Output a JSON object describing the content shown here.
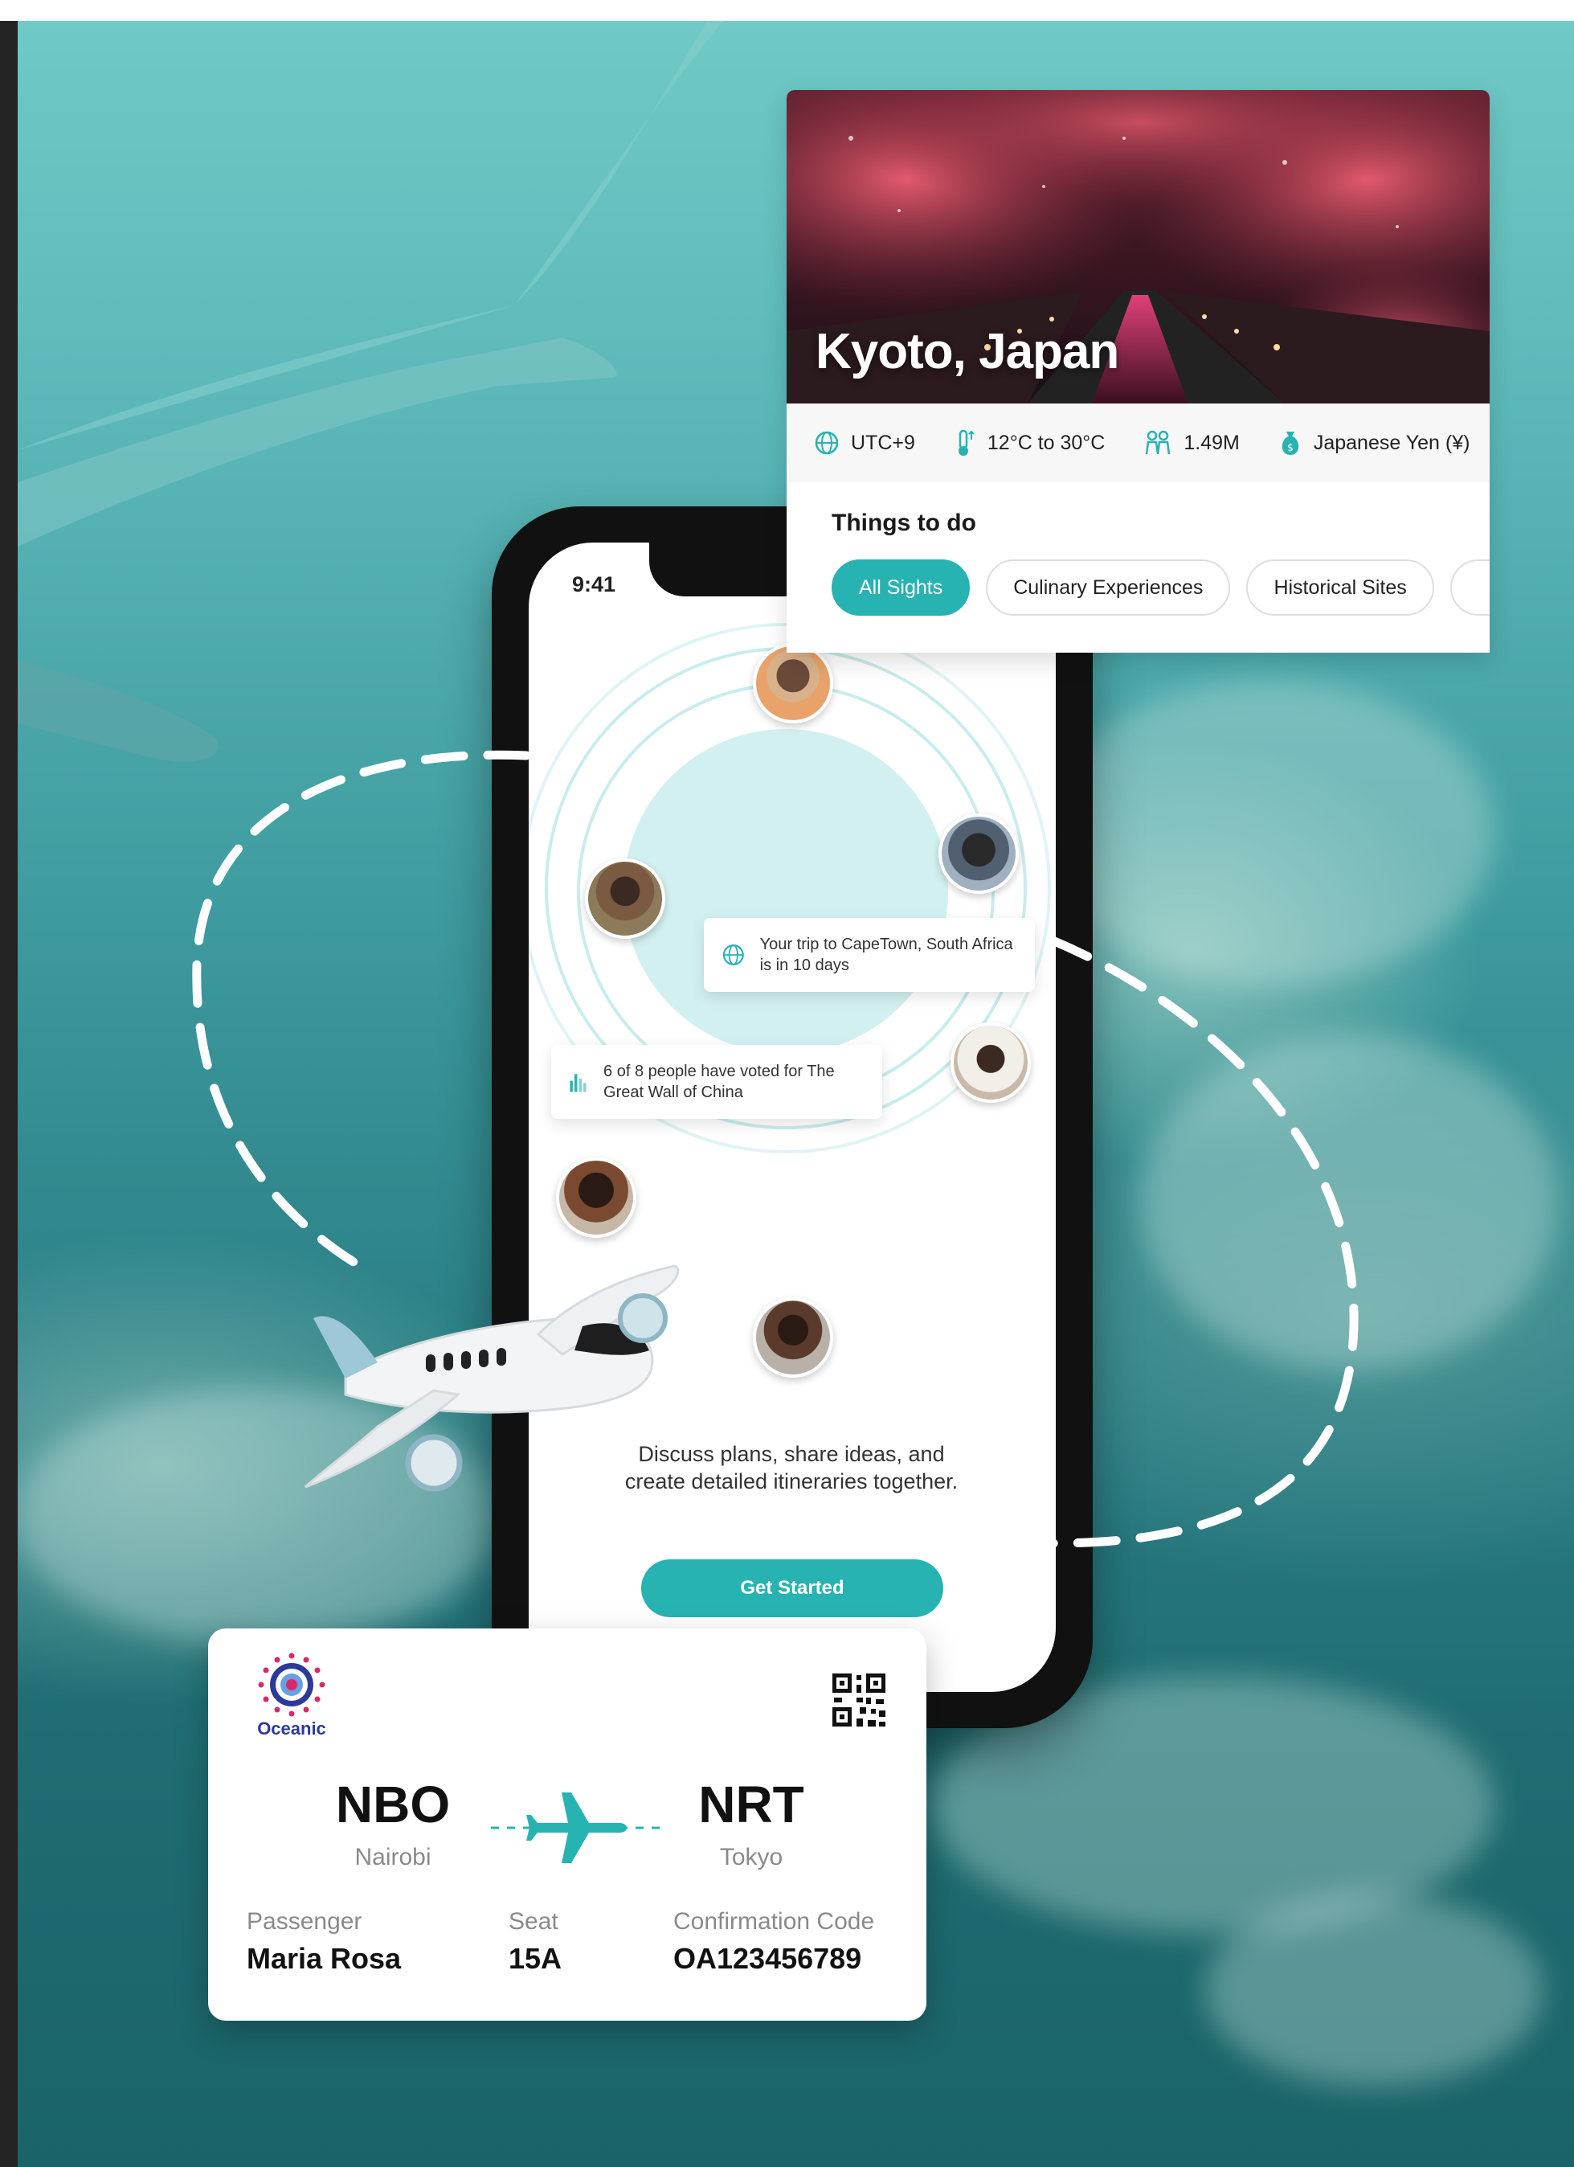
{
  "phone": {
    "status_time": "9:41",
    "trip_notice": "Your trip to CapeTown, South Africa is in 10 days",
    "vote_notice": "6 of 8 people have voted for The Great Wall of China",
    "tagline": "Discuss plans, share ideas, and create detailed itineraries together.",
    "cta_label": "Get Started"
  },
  "city_card": {
    "title": "Kyoto, Japan",
    "facts": {
      "timezone": "UTC+9",
      "temperature": "12°C to 30°C",
      "population": "1.49M",
      "currency": "Japanese Yen (¥)"
    },
    "things_title": "Things to do",
    "chips": [
      {
        "label": "All Sights",
        "active": true
      },
      {
        "label": "Culinary Experiences",
        "active": false
      },
      {
        "label": "Historical Sites",
        "active": false
      }
    ]
  },
  "boarding_pass": {
    "airline": "Oceanic",
    "origin_code": "NBO",
    "origin_city": "Nairobi",
    "destination_code": "NRT",
    "destination_city": "Tokyo",
    "passenger_label": "Passenger",
    "passenger_name": "Maria Rosa",
    "seat_label": "Seat",
    "seat": "15A",
    "confirmation_label": "Confirmation Code",
    "confirmation_code": "OA123456789"
  },
  "colors": {
    "accent": "#27b3b1",
    "sky_top": "#6fc9c6",
    "sky_bottom": "#1a6469",
    "airline_blue": "#2b3a99"
  }
}
